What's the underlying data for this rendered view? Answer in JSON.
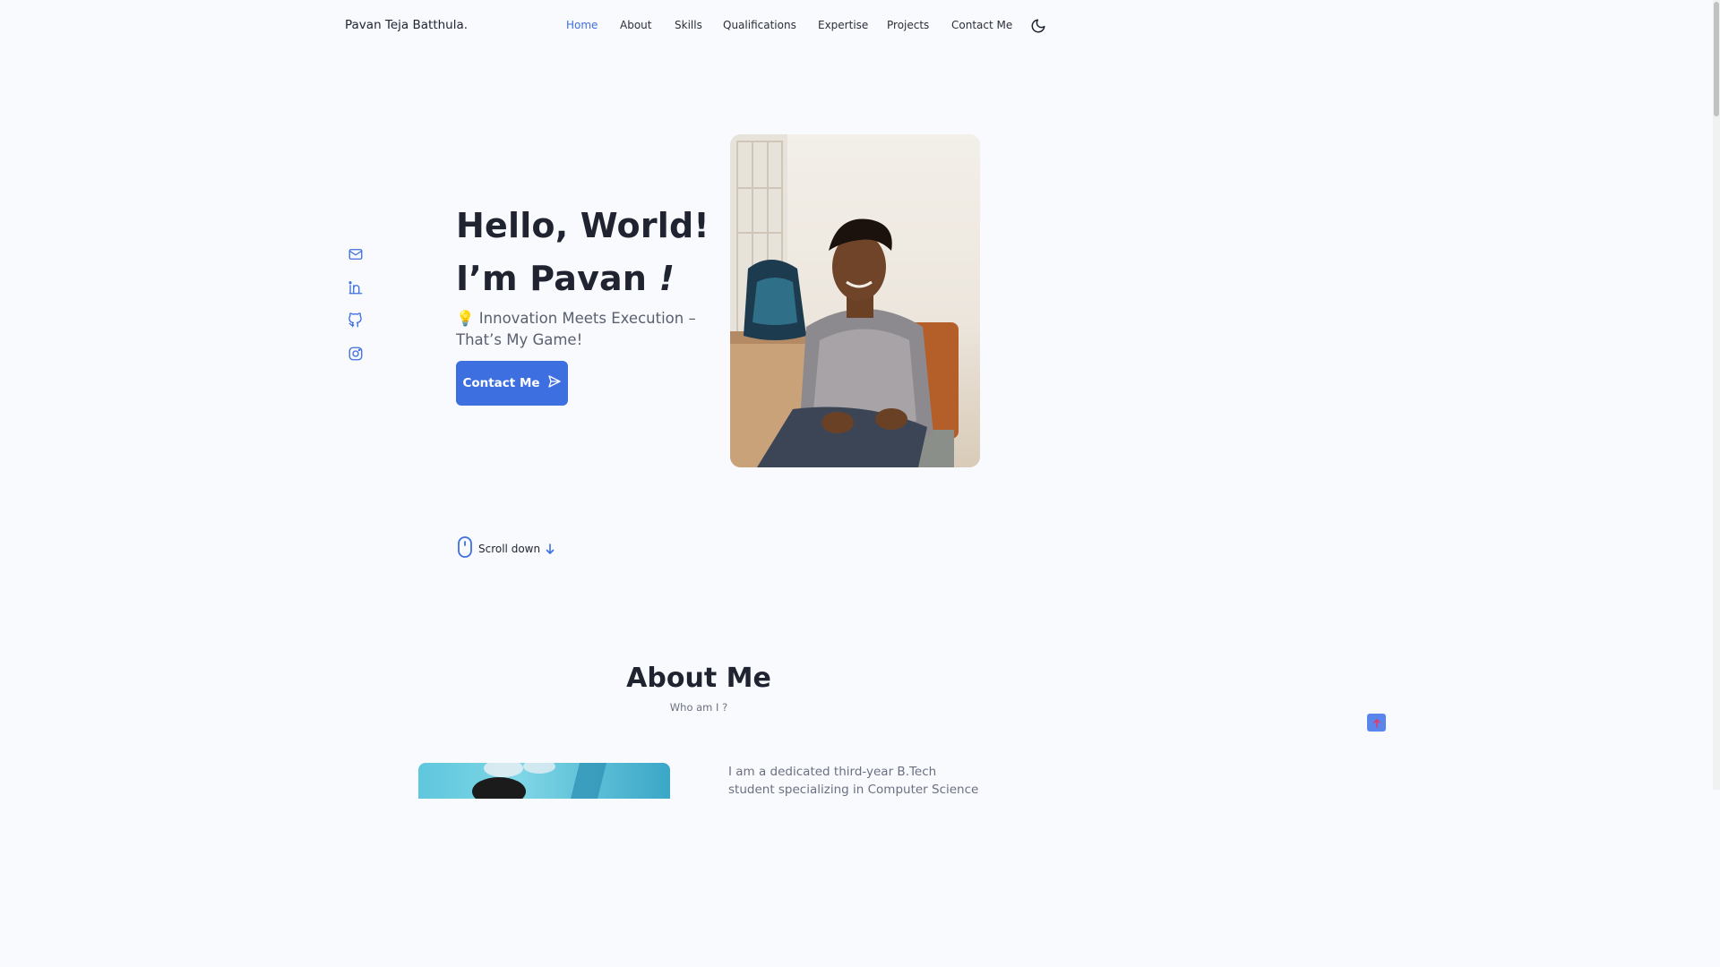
{
  "header": {
    "logo": "Pavan Teja Batthula.",
    "nav": [
      {
        "label": "Home",
        "active": true
      },
      {
        "label": "About",
        "active": false
      },
      {
        "label": "Skills",
        "active": false
      },
      {
        "label": "Qualifications",
        "active": false
      },
      {
        "label": "Expertise",
        "active": false
      },
      {
        "label": "Projects",
        "active": false
      },
      {
        "label": "Contact Me",
        "active": false
      }
    ],
    "theme_toggle_icon": "moon-icon"
  },
  "social": [
    {
      "icon": "mail-icon"
    },
    {
      "icon": "linkedin-icon"
    },
    {
      "icon": "github-icon"
    },
    {
      "icon": "instagram-icon"
    }
  ],
  "hero": {
    "title_line1": "Hello, World!",
    "title_line2": "I’m Pavan ",
    "title_exclaim": "!",
    "subtitle": "💡 Innovation Meets Execution – That’s My Game!",
    "cta_label": "Contact Me",
    "cta_icon": "send-icon",
    "photo_icon": "profile-photo"
  },
  "scroll": {
    "label": "Scroll down",
    "mouse_icon": "mouse-icon",
    "arrow_icon": "arrow-down-icon"
  },
  "about": {
    "title": "About Me",
    "subtitle": "Who am I ?",
    "text": "I am a dedicated third-year B.Tech student specializing in Computer Science"
  },
  "back_to_top_icon": "arrow-up-icon",
  "colors": {
    "accent": "#3d6fe0",
    "background": "#f9fafe",
    "text": "#1f2430",
    "muted": "#6b7080"
  }
}
